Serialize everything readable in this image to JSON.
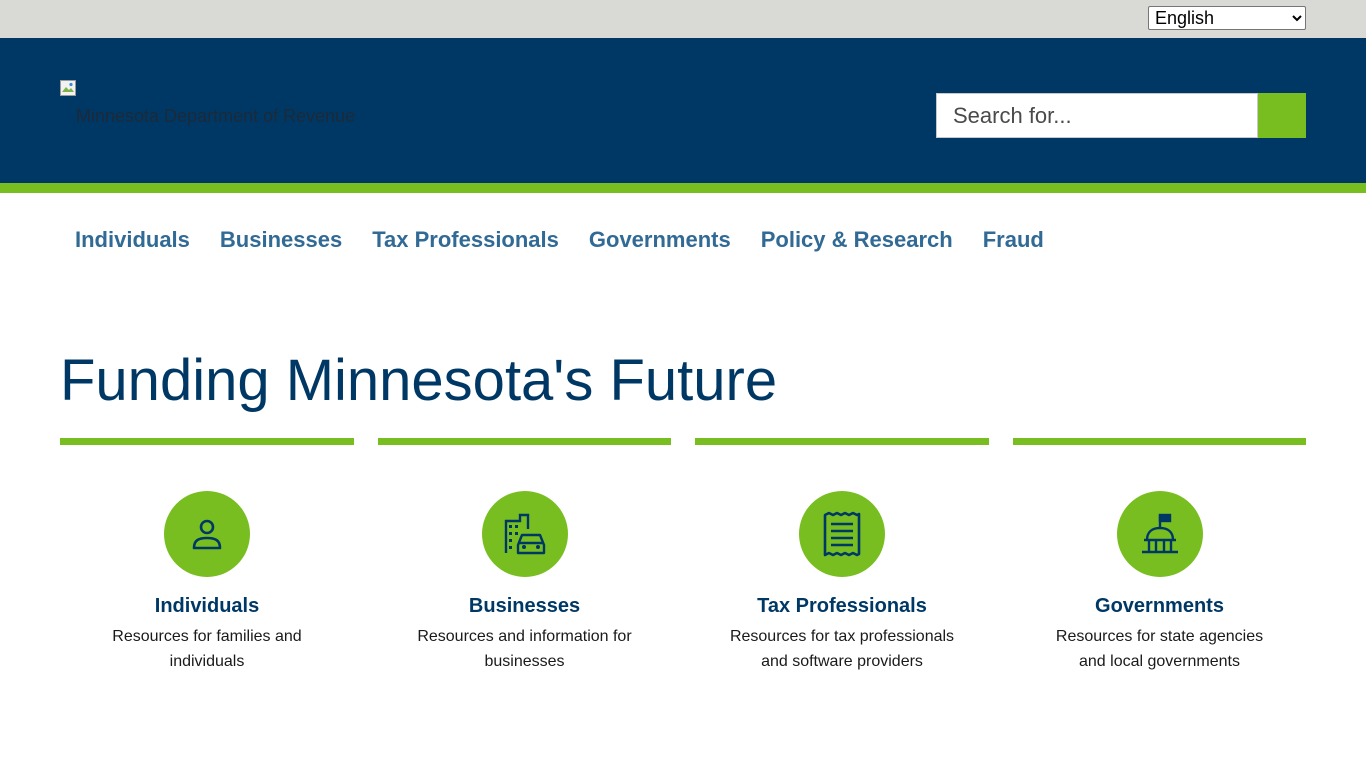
{
  "utility": {
    "language_selected": "English",
    "language_options": [
      "English"
    ]
  },
  "header": {
    "logo_alt": "Minnesota Department of Revenue",
    "search_placeholder": "Search for..."
  },
  "nav": {
    "items": [
      "Individuals",
      "Businesses",
      "Tax Professionals",
      "Governments",
      "Policy & Research",
      "Fraud"
    ]
  },
  "hero": {
    "title": "Funding Minnesota's Future"
  },
  "cards": [
    {
      "title": "Individuals",
      "description": "Resources for families and individuals",
      "icon": "person-icon"
    },
    {
      "title": "Businesses",
      "description": "Resources and information for businesses",
      "icon": "building-car-icon"
    },
    {
      "title": "Tax Professionals",
      "description": "Resources for tax professionals and software providers",
      "icon": "receipt-icon"
    },
    {
      "title": "Governments",
      "description": "Resources for state agencies and local governments",
      "icon": "capitol-icon"
    }
  ],
  "colors": {
    "navy": "#003865",
    "green": "#78be21",
    "nav_link": "#316a95",
    "utility_bg": "#d9d9d6"
  }
}
